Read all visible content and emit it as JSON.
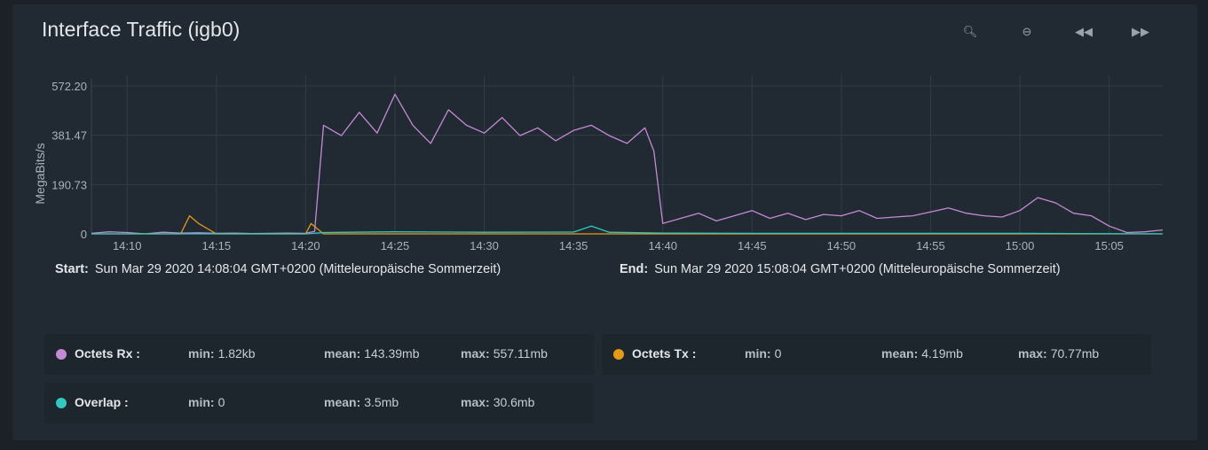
{
  "title": "Interface Traffic (igb0)",
  "toolbar": [
    {
      "name": "zoom-in-icon",
      "glyph": "🔍︎"
    },
    {
      "name": "zoom-out-icon",
      "glyph": "⊖"
    },
    {
      "name": "rewind-icon",
      "glyph": "◀◀"
    },
    {
      "name": "fast-forward-icon",
      "glyph": "▶▶"
    }
  ],
  "range": {
    "start_label": "Start:",
    "start_value": "Sun Mar 29 2020 14:08:04 GMT+0200 (Mitteleuropäische Sommerzeit)",
    "end_label": "End:",
    "end_value": "Sun Mar 29 2020 15:08:04 GMT+0200 (Mitteleuropäische Sommerzeit)"
  },
  "legend": [
    {
      "name": "Octets Rx :",
      "color": "#c48ad4",
      "min_label": "min:",
      "min": "1.82kb",
      "mean_label": "mean:",
      "mean": "143.39mb",
      "max_label": "max:",
      "max": "557.11mb"
    },
    {
      "name": "Octets Tx :",
      "color": "#e69a12",
      "min_label": "min:",
      "min": "0",
      "mean_label": "mean:",
      "mean": "4.19mb",
      "max_label": "max:",
      "max": "70.77mb"
    },
    {
      "name": "Overlap :",
      "color": "#2fc8c2",
      "min_label": "min:",
      "min": "0",
      "mean_label": "mean:",
      "mean": "3.5mb",
      "max_label": "max:",
      "max": "30.6mb"
    }
  ],
  "chart_data": {
    "type": "line",
    "ylabel": "MegaBits/s",
    "yticks": [
      "0",
      "190.73",
      "381.47",
      "572.20"
    ],
    "ytick_values": [
      0,
      190.73,
      381.47,
      572.2
    ],
    "ylim": [
      0,
      572.2
    ],
    "xlim": [
      "14:08",
      "15:08"
    ],
    "xticks": [
      "14:10",
      "14:15",
      "14:20",
      "14:25",
      "14:30",
      "14:35",
      "14:40",
      "14:45",
      "14:50",
      "14:55",
      "15:00",
      "15:05"
    ],
    "grid": true,
    "series": [
      {
        "name": "Octets Rx",
        "color": "#c48ad4",
        "x": [
          "14:08",
          "14:09",
          "14:10",
          "14:11",
          "14:12",
          "14:13",
          "14:14",
          "14:15",
          "14:16",
          "14:17",
          "14:18",
          "14:19",
          "14:20",
          "14:20.5",
          "14:21",
          "14:22",
          "14:23",
          "14:24",
          "14:25",
          "14:26",
          "14:27",
          "14:28",
          "14:29",
          "14:30",
          "14:31",
          "14:32",
          "14:33",
          "14:34",
          "14:35",
          "14:36",
          "14:37",
          "14:38",
          "14:39",
          "14:39.5",
          "14:40",
          "14:41",
          "14:42",
          "14:43",
          "14:44",
          "14:45",
          "14:46",
          "14:47",
          "14:48",
          "14:49",
          "14:50",
          "14:51",
          "14:52",
          "14:53",
          "14:54",
          "14:55",
          "14:56",
          "14:57",
          "14:58",
          "14:59",
          "15:00",
          "15:01",
          "15:02",
          "15:03",
          "15:04",
          "15:05",
          "15:06",
          "15:07",
          "15:08"
        ],
        "y": [
          2,
          8,
          5,
          0,
          6,
          3,
          4,
          2,
          3,
          1,
          2,
          3,
          2,
          10,
          420,
          380,
          470,
          390,
          540,
          420,
          350,
          480,
          420,
          390,
          450,
          380,
          410,
          360,
          400,
          420,
          380,
          350,
          410,
          320,
          40,
          60,
          80,
          50,
          70,
          90,
          60,
          80,
          55,
          75,
          70,
          90,
          60,
          65,
          70,
          85,
          100,
          80,
          70,
          65,
          90,
          140,
          120,
          80,
          70,
          30,
          5,
          8,
          15
        ]
      },
      {
        "name": "Octets Tx",
        "color": "#e69a12",
        "x": [
          "14:08",
          "14:12",
          "14:13",
          "14:13.5",
          "14:14",
          "14:15",
          "14:19",
          "14:20",
          "14:20.3",
          "14:21",
          "15:08"
        ],
        "y": [
          0,
          0,
          0,
          70,
          40,
          0,
          0,
          0,
          40,
          0,
          0
        ]
      },
      {
        "name": "Overlap",
        "color": "#2fc8c2",
        "x": [
          "14:08",
          "14:20",
          "14:21",
          "14:25",
          "14:30",
          "14:35",
          "14:36",
          "14:37",
          "14:40",
          "14:45",
          "15:00",
          "15:08"
        ],
        "y": [
          0,
          0,
          5,
          8,
          6,
          7,
          30,
          6,
          3,
          2,
          2,
          0
        ]
      }
    ]
  }
}
